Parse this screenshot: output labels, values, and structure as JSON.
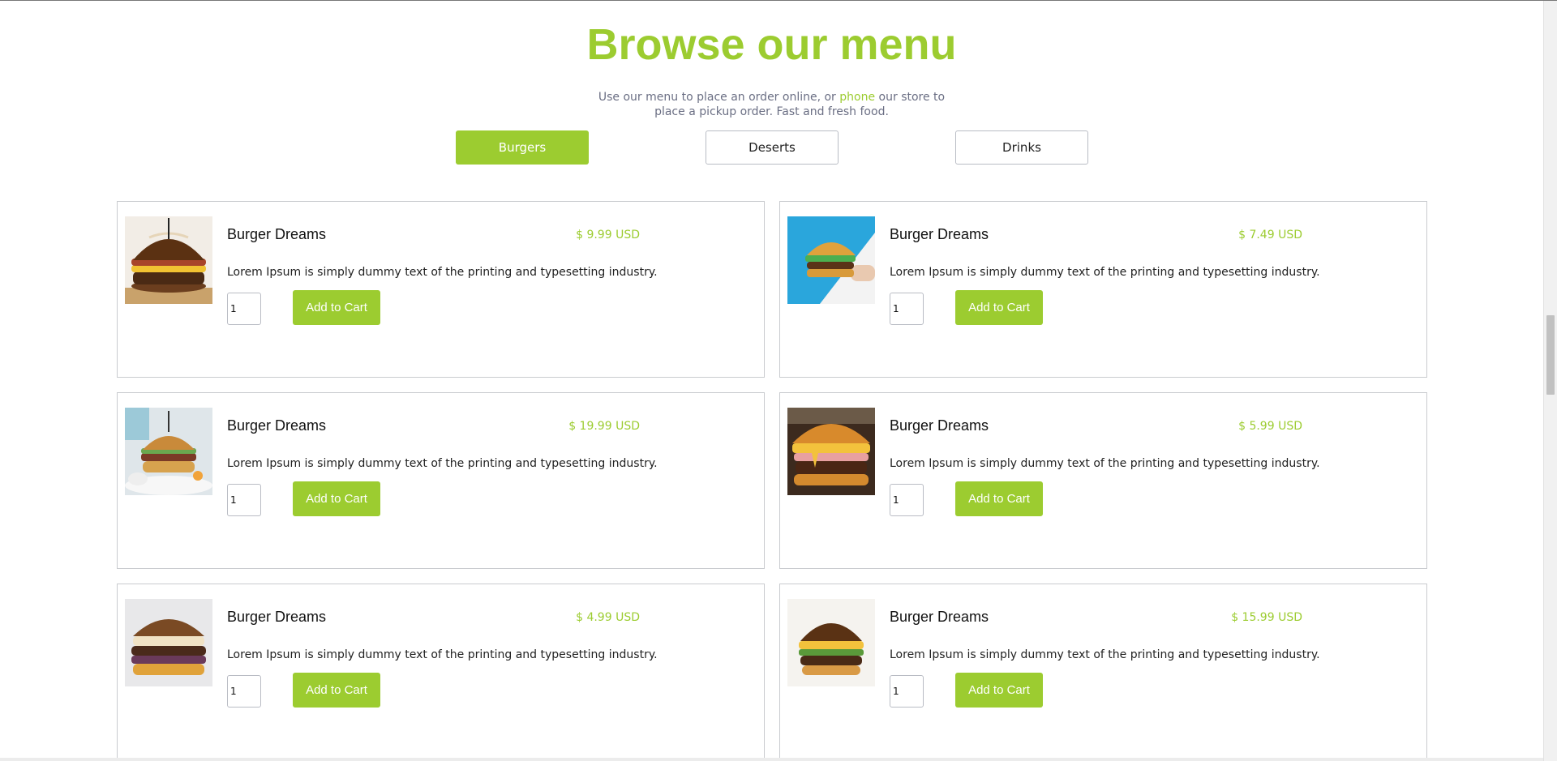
{
  "colors": {
    "accent": "#9ccc30",
    "subtitle_text": "#6b6f84",
    "border": "#c9cbcf"
  },
  "menu": {
    "title": "Browse our menu",
    "subtitle": {
      "line1_before": "Use our menu to place an order online, or ",
      "link": "phone",
      "line1_after": " our store to",
      "line2": "place a pickup order. Fast and fresh food."
    },
    "tabs": [
      {
        "label": "Burgers",
        "active": true
      },
      {
        "label": "Deserts",
        "active": false
      },
      {
        "label": "Drinks",
        "active": false
      }
    ]
  },
  "items": [
    {
      "name": "Burger Dreams",
      "price": "$ 9.99 USD",
      "description": "Lorem Ipsum is simply dummy text of the printing and typesetting industry.",
      "quantity": "1",
      "button_label": "Add to Cart",
      "image_icon": "pretzel-burger-image"
    },
    {
      "name": "Burger Dreams",
      "price": "$ 7.49 USD",
      "description": "Lorem Ipsum is simply dummy text of the printing and typesetting industry.",
      "quantity": "1",
      "button_label": "Add to Cart",
      "image_icon": "hand-held-burger-image"
    },
    {
      "name": "Burger Dreams",
      "price": "$ 19.99 USD",
      "description": "Lorem Ipsum is simply dummy text of the printing and typesetting industry.",
      "quantity": "1",
      "button_label": "Add to Cart",
      "image_icon": "plated-burger-image"
    },
    {
      "name": "Burger Dreams",
      "price": "$ 5.99 USD",
      "description": "Lorem Ipsum is simply dummy text of the printing and typesetting industry.",
      "quantity": "1",
      "button_label": "Add to Cart",
      "image_icon": "cheese-burger-image"
    },
    {
      "name": "Burger Dreams",
      "price": "$ 4.99 USD",
      "description": "Lorem Ipsum is simply dummy text of the printing and typesetting industry.",
      "quantity": "1",
      "button_label": "Add to Cart",
      "image_icon": "onion-burger-image"
    },
    {
      "name": "Burger Dreams",
      "price": "$ 15.99 USD",
      "description": "Lorem Ipsum is simply dummy text of the printing and typesetting industry.",
      "quantity": "1",
      "button_label": "Add to Cart",
      "image_icon": "brioche-burger-image"
    }
  ]
}
